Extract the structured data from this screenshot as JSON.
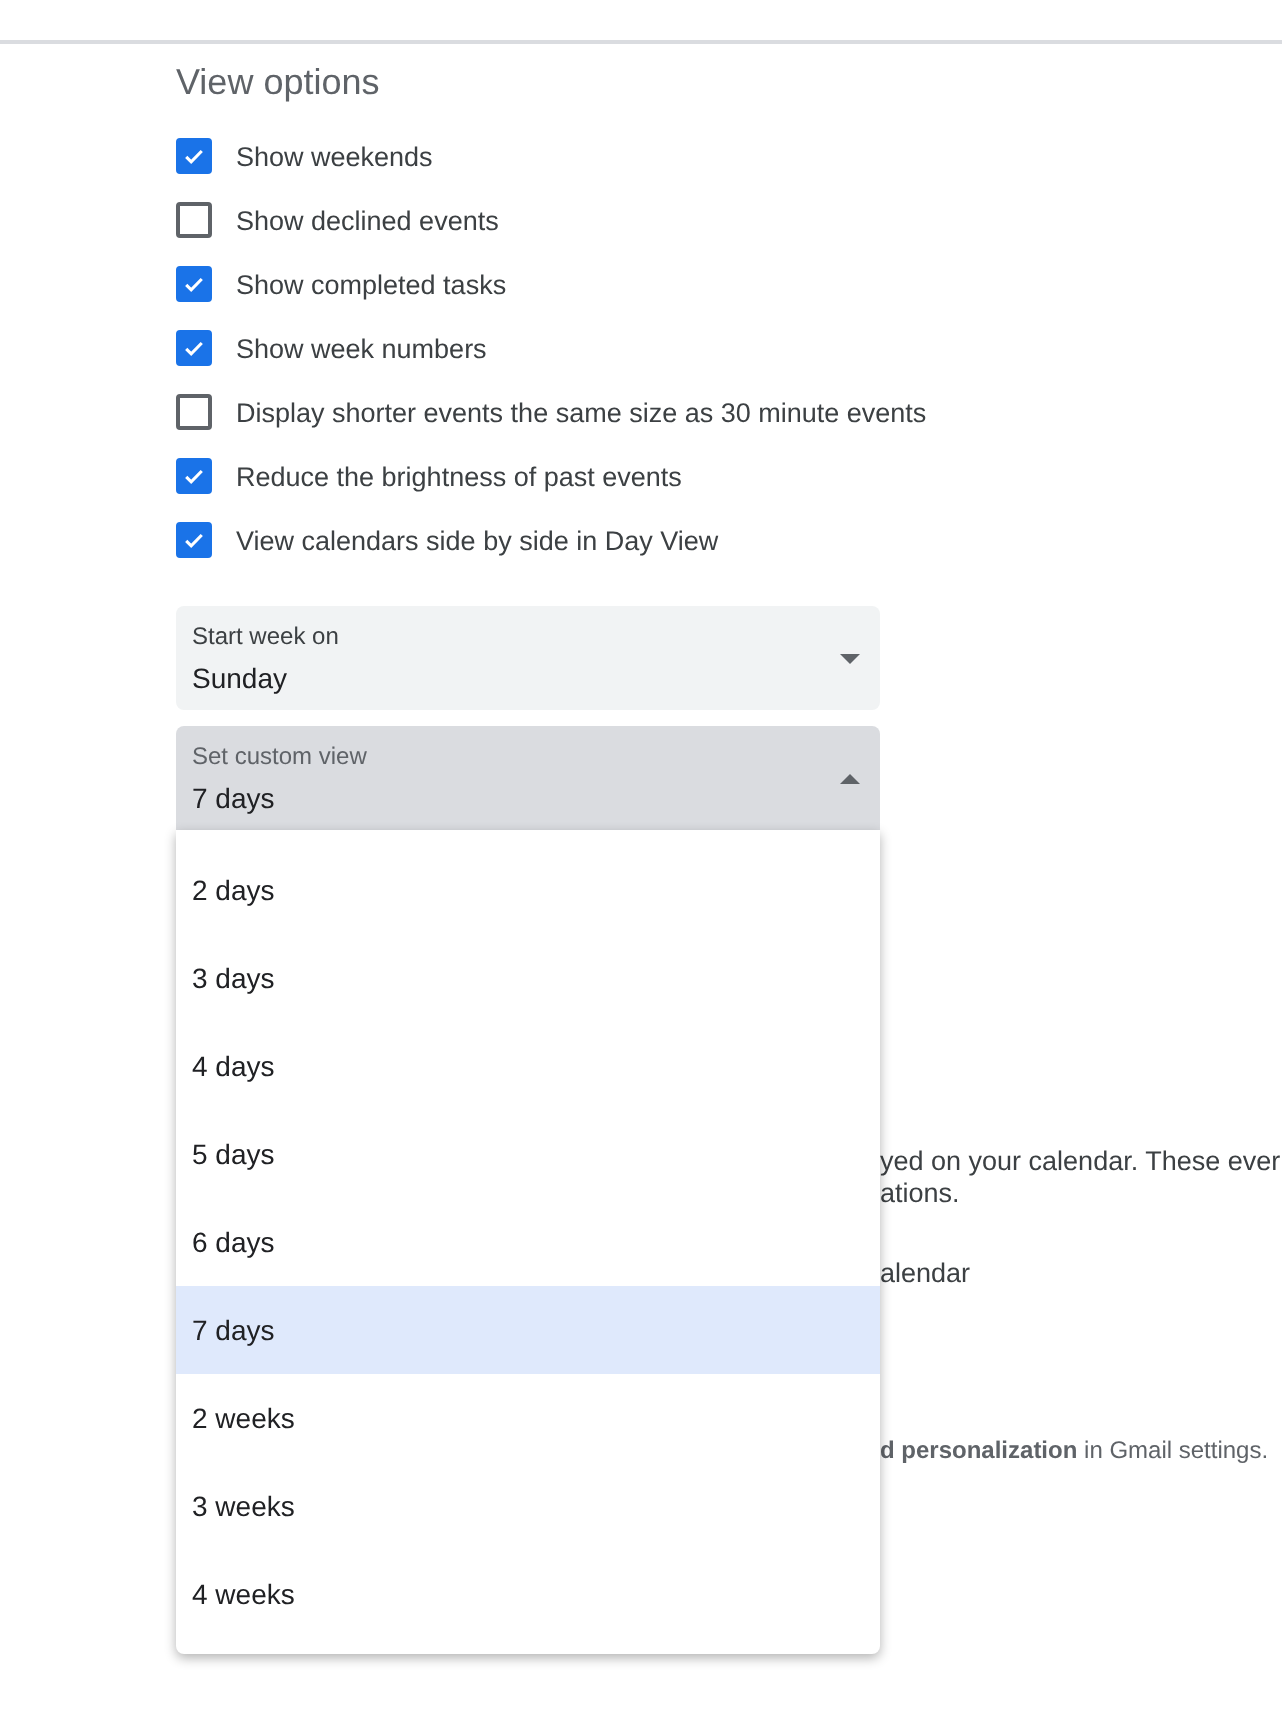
{
  "section_title": "View options",
  "options": [
    {
      "label": "Show weekends",
      "checked": true
    },
    {
      "label": "Show declined events",
      "checked": false
    },
    {
      "label": "Show completed tasks",
      "checked": true
    },
    {
      "label": "Show week numbers",
      "checked": true
    },
    {
      "label": "Display shorter events the same size as 30 minute events",
      "checked": false
    },
    {
      "label": "Reduce the brightness of past events",
      "checked": true
    },
    {
      "label": "View calendars side by side in Day View",
      "checked": true
    }
  ],
  "start_week": {
    "label": "Start week on",
    "value": "Sunday",
    "expanded": false
  },
  "custom_view": {
    "label": "Set custom view",
    "value": "7 days",
    "expanded": true,
    "menu": [
      {
        "label": "2 days",
        "selected": false
      },
      {
        "label": "3 days",
        "selected": false
      },
      {
        "label": "4 days",
        "selected": false
      },
      {
        "label": "5 days",
        "selected": false
      },
      {
        "label": "6 days",
        "selected": false
      },
      {
        "label": "7 days",
        "selected": true
      },
      {
        "label": "2 weeks",
        "selected": false
      },
      {
        "label": "3 weeks",
        "selected": false
      },
      {
        "label": "4 weeks",
        "selected": false
      }
    ]
  },
  "hidden_texts": [
    "yed on your calendar. These ever",
    "ations.",
    "alendar",
    "**d personalization** in Gmail settings."
  ]
}
